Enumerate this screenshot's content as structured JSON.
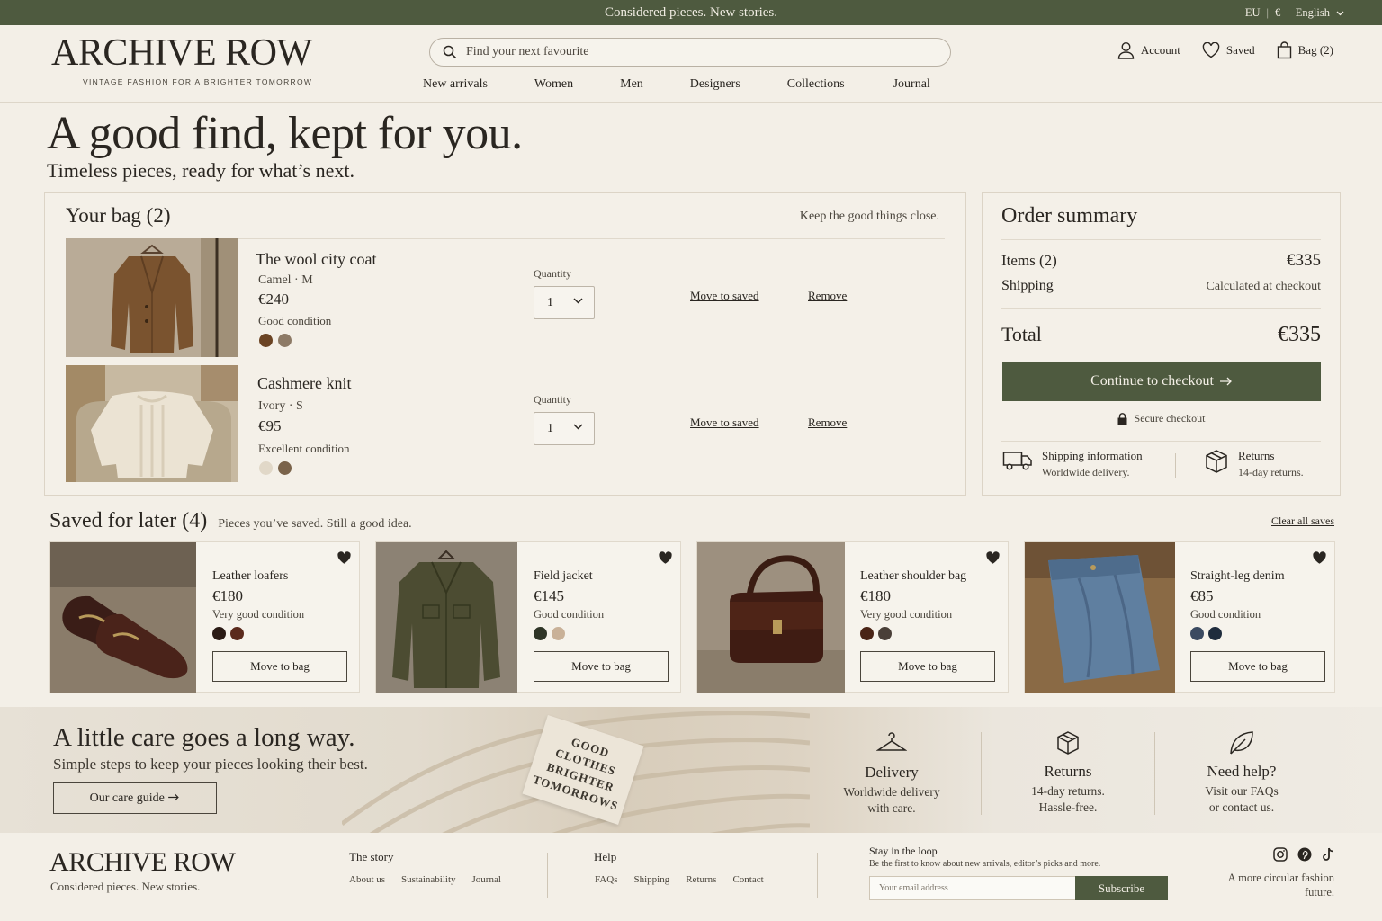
{
  "announcement": {
    "message": "Considered pieces. New stories.",
    "region": "EU",
    "currency": "€",
    "language": "English"
  },
  "header": {
    "logo": "ARCHIVE ROW",
    "tagline": "VINTAGE FASHION FOR A BRIGHTER TOMORROW",
    "search_placeholder": "Find your next favourite",
    "nav": [
      "New arrivals",
      "Women",
      "Men",
      "Designers",
      "Collections",
      "Journal"
    ],
    "account": "Account",
    "saved": "Saved",
    "bag": "Bag (2)"
  },
  "hero": {
    "title": "A good find, kept for you.",
    "subtitle": "Timeless pieces, ready for what’s next."
  },
  "bag": {
    "title": "Your bag (2)",
    "note": "Keep the good things close.",
    "quantity_label": "Quantity",
    "move_label": "Move to saved",
    "remove_label": "Remove",
    "items": [
      {
        "name": "The wool city coat",
        "color": "Camel",
        "size": "M",
        "price": "€240",
        "condition": "Good condition",
        "quantity": "1",
        "swatches": [
          "#6b4424",
          "#8d7a66"
        ]
      },
      {
        "name": "Cashmere knit",
        "color": "Ivory",
        "size": "S",
        "price": "€95",
        "condition": "Excellent condition",
        "quantity": "1",
        "swatches": [
          "#e1d8c8",
          "#7a634a"
        ]
      }
    ]
  },
  "summary": {
    "title": "Order summary",
    "items_label": "Items (2)",
    "items_value": "€335",
    "shipping_label": "Shipping",
    "shipping_value": "Calculated at checkout",
    "total_label": "Total",
    "total_value": "€335",
    "checkout": "Continue to checkout",
    "secure": "Secure checkout",
    "shipping_info_title": "Shipping information",
    "shipping_info_sub": "Worldwide delivery.",
    "returns_title": "Returns",
    "returns_sub": "14-day returns."
  },
  "saved": {
    "title": "Saved for later (4)",
    "subtitle": "Pieces you’ve saved. Still a good idea.",
    "clear": "Clear all saves",
    "move_label": "Move to bag",
    "items": [
      {
        "name": "Leather loafers",
        "price": "€180",
        "condition": "Very good condition",
        "swatches": [
          "#2a1a14",
          "#5b2a1c"
        ]
      },
      {
        "name": "Field jacket",
        "price": "€145",
        "condition": "Good condition",
        "swatches": [
          "#2f3527",
          "#c9b198"
        ]
      },
      {
        "name": "Leather shoulder bag",
        "price": "€180",
        "condition": "Very good condition",
        "swatches": [
          "#4a2416",
          "#4a3f38"
        ]
      },
      {
        "name": "Straight-leg denim",
        "price": "€85",
        "condition": "Good condition",
        "swatches": [
          "#3b4a61",
          "#1f2c3d"
        ]
      }
    ]
  },
  "care": {
    "title": "A little care goes a long way.",
    "subtitle": "Simple steps to keep your pieces looking their best.",
    "button": "Our care guide",
    "tag_lines": [
      "GOOD",
      "CLOTHES",
      "BRIGHTER",
      "TOMORROWS"
    ],
    "delivery_title": "Delivery",
    "delivery_line1": "Worldwide delivery",
    "delivery_line2": "with care.",
    "returns_title": "Returns",
    "returns_line1": "14-day returns.",
    "returns_line2": "Hassle-free.",
    "help_title": "Need help?",
    "help_line1": "Visit our FAQs",
    "help_line2": "or contact us."
  },
  "footer": {
    "logo": "ARCHIVE ROW",
    "tagline": "Considered pieces. New stories.",
    "story_title": "The story",
    "story_links": [
      "About us",
      "Sustainability",
      "Journal"
    ],
    "help_title": "Help",
    "help_links": [
      "FAQs",
      "Shipping",
      "Returns",
      "Contact"
    ],
    "newsletter_title": "Stay in the loop",
    "newsletter_text": "Be the first to know about new arrivals, editor’s picks and more.",
    "email_placeholder": "Your email address",
    "subscribe": "Subscribe",
    "closing": "A more circular fashion future."
  },
  "colors": {
    "brand_green": "#4e5a3f",
    "background": "#f3efe7"
  }
}
